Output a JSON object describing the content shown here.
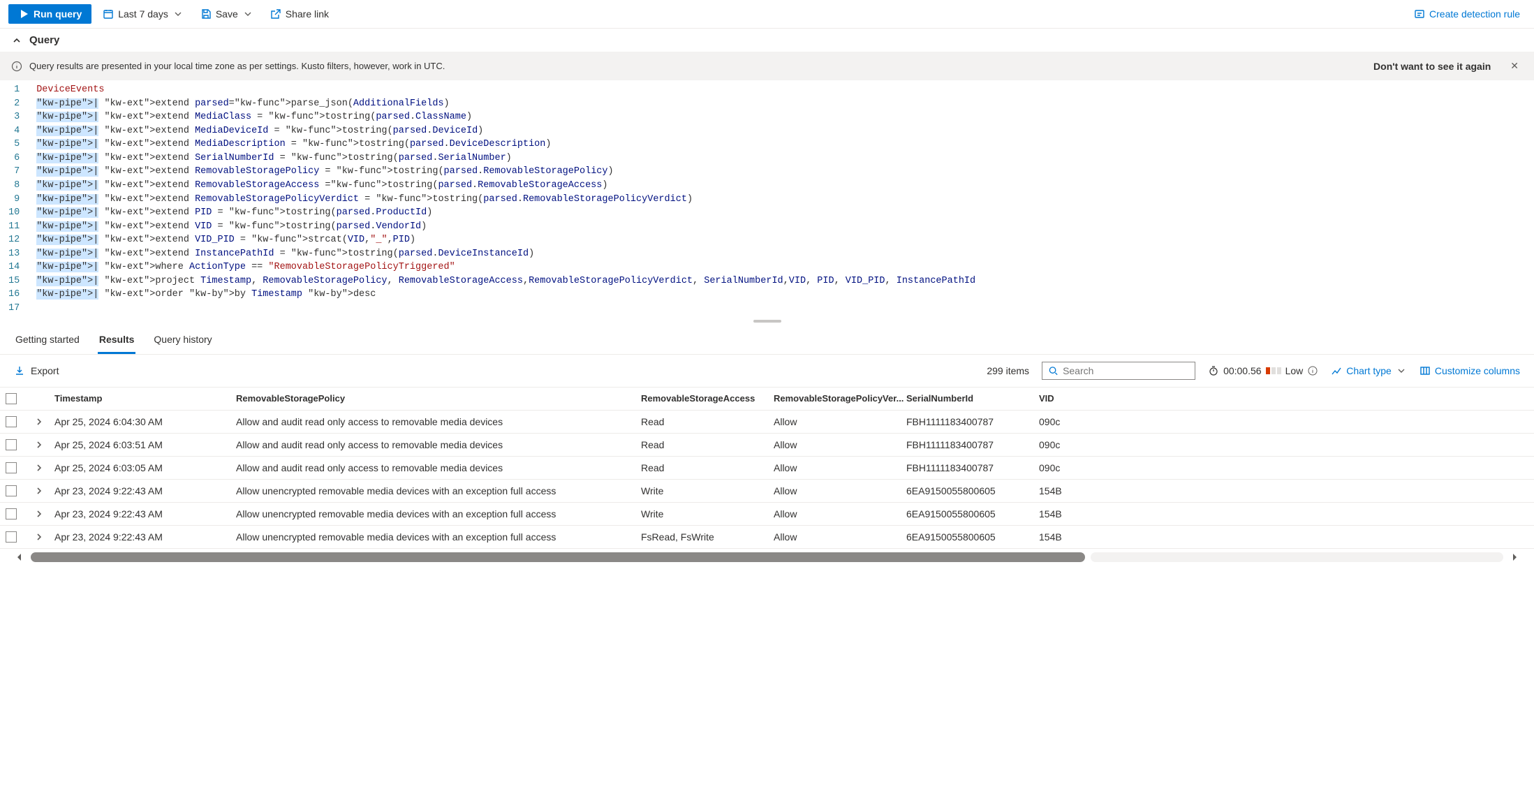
{
  "toolbar": {
    "run": "Run query",
    "timerange": "Last 7 days",
    "save": "Save",
    "share": "Share link",
    "create_rule": "Create detection rule"
  },
  "query_section": {
    "title": "Query"
  },
  "banner": {
    "text": "Query results are presented in your local time zone as per settings. Kusto filters, however, work in UTC.",
    "dismiss": "Don't want to see it again"
  },
  "editor": {
    "lines": [
      {
        "n": "1",
        "raw": "DeviceEvents"
      },
      {
        "n": "2",
        "raw": "| extend parsed=parse_json(AdditionalFields)"
      },
      {
        "n": "3",
        "raw": "| extend MediaClass = tostring(parsed.ClassName)"
      },
      {
        "n": "4",
        "raw": "| extend MediaDeviceId = tostring(parsed.DeviceId)"
      },
      {
        "n": "5",
        "raw": "| extend MediaDescription = tostring(parsed.DeviceDescription)"
      },
      {
        "n": "6",
        "raw": "| extend SerialNumberId = tostring(parsed.SerialNumber)"
      },
      {
        "n": "7",
        "raw": "| extend RemovableStoragePolicy = tostring(parsed.RemovableStoragePolicy)"
      },
      {
        "n": "8",
        "raw": "| extend RemovableStorageAccess =tostring(parsed.RemovableStorageAccess)"
      },
      {
        "n": "9",
        "raw": "| extend RemovableStoragePolicyVerdict = tostring(parsed.RemovableStoragePolicyVerdict)"
      },
      {
        "n": "10",
        "raw": "| extend PID = tostring(parsed.ProductId)"
      },
      {
        "n": "11",
        "raw": "| extend VID = tostring(parsed.VendorId)"
      },
      {
        "n": "12",
        "raw": "| extend VID_PID = strcat(VID,\"_\",PID)"
      },
      {
        "n": "13",
        "raw": "| extend InstancePathId = tostring(parsed.DeviceInstanceId)"
      },
      {
        "n": "14",
        "raw": "| where ActionType == \"RemovableStoragePolicyTriggered\""
      },
      {
        "n": "15",
        "raw": "| project Timestamp, RemovableStoragePolicy, RemovableStorageAccess,RemovableStoragePolicyVerdict, SerialNumberId,VID, PID, VID_PID, InstancePathId"
      },
      {
        "n": "16",
        "raw": "| order by Timestamp desc"
      },
      {
        "n": "17",
        "raw": ""
      }
    ]
  },
  "tabs": {
    "getting_started": "Getting started",
    "results": "Results",
    "history": "Query history"
  },
  "results": {
    "export": "Export",
    "count": "299 items",
    "search_placeholder": "Search",
    "time": "00:00.56",
    "load": "Low",
    "chart": "Chart type",
    "customize": "Customize columns",
    "columns": {
      "timestamp": "Timestamp",
      "policy": "RemovableStoragePolicy",
      "access": "RemovableStorageAccess",
      "verdict": "RemovableStoragePolicyVer...",
      "serial": "SerialNumberId",
      "vid": "VID"
    },
    "rows": [
      {
        "ts": "Apr 25, 2024 6:04:30 AM",
        "policy": "Allow and audit read only access to removable media devices",
        "access": "Read",
        "verdict": "Allow",
        "serial": "FBH1111183400787",
        "vid": "090c"
      },
      {
        "ts": "Apr 25, 2024 6:03:51 AM",
        "policy": "Allow and audit read only access to removable media devices",
        "access": "Read",
        "verdict": "Allow",
        "serial": "FBH1111183400787",
        "vid": "090c"
      },
      {
        "ts": "Apr 25, 2024 6:03:05 AM",
        "policy": "Allow and audit read only access to removable media devices",
        "access": "Read",
        "verdict": "Allow",
        "serial": "FBH1111183400787",
        "vid": "090c"
      },
      {
        "ts": "Apr 23, 2024 9:22:43 AM",
        "policy": "Allow unencrypted removable media devices with an exception full access",
        "access": "Write",
        "verdict": "Allow",
        "serial": "6EA9150055800605",
        "vid": "154B"
      },
      {
        "ts": "Apr 23, 2024 9:22:43 AM",
        "policy": "Allow unencrypted removable media devices with an exception full access",
        "access": "Write",
        "verdict": "Allow",
        "serial": "6EA9150055800605",
        "vid": "154B"
      },
      {
        "ts": "Apr 23, 2024 9:22:43 AM",
        "policy": "Allow unencrypted removable media devices with an exception full access",
        "access": "FsRead, FsWrite",
        "verdict": "Allow",
        "serial": "6EA9150055800605",
        "vid": "154B"
      }
    ]
  }
}
